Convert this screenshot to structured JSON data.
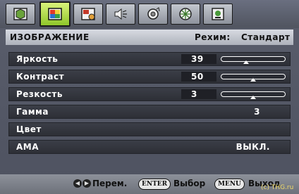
{
  "tabs": [
    {
      "name": "picture-settings-icon",
      "active": false
    },
    {
      "name": "picture-icon",
      "active": true
    },
    {
      "name": "pip-icon",
      "active": false
    },
    {
      "name": "audio-icon",
      "active": false
    },
    {
      "name": "setup-icon",
      "active": false
    },
    {
      "name": "info-icon",
      "active": false
    },
    {
      "name": "options-icon",
      "active": false
    }
  ],
  "header": {
    "title": "ИЗОБРАЖЕНИЕ",
    "mode_label": "Рехим:",
    "mode_value": "Стандарт"
  },
  "rows": {
    "brightness": {
      "label": "Яркость",
      "value": "39",
      "level": 0.39
    },
    "contrast": {
      "label": "Контраст",
      "value": "50",
      "level": 0.5
    },
    "sharpness": {
      "label": "Резкость",
      "value": "3",
      "level": 0.5
    },
    "gamma": {
      "label": "Гамма",
      "value": "3"
    },
    "color": {
      "label": "Цвет"
    },
    "ama": {
      "label": "AMA",
      "value": "ВЫКЛ."
    }
  },
  "footer": {
    "move_label": "Перем.",
    "enter_key": "ENTER",
    "select_label": "Выбор",
    "menu_key": "MENU",
    "exit_label": "Выход"
  },
  "watermark": "(c) THG.ru"
}
